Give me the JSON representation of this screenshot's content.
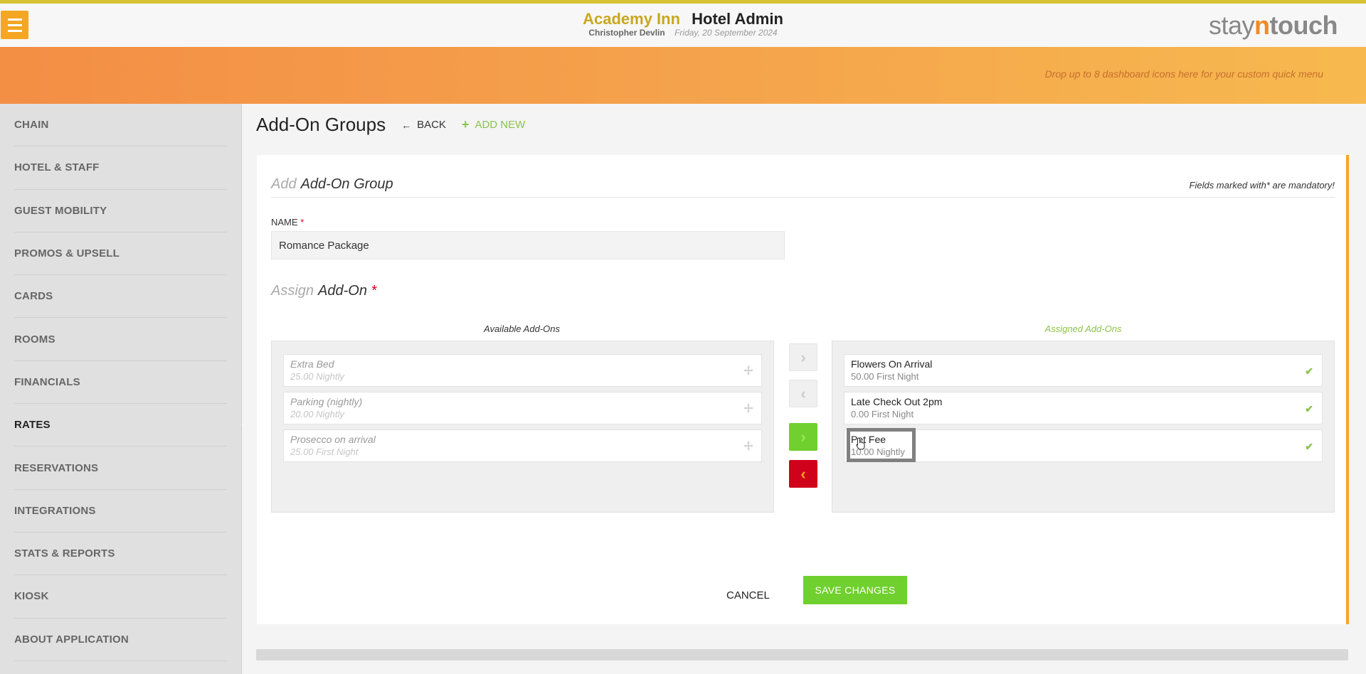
{
  "header": {
    "hotel_name": "Academy Inn",
    "admin_label": "Hotel Admin",
    "user_name": "Christopher Devlin",
    "date": "Friday, 20 September 2024",
    "brand_prefix": "stay",
    "brand_n": "n",
    "brand_suffix": "touch"
  },
  "quickbar": {
    "hint": "Drop up to 8 dashboard icons here for your custom quick menu"
  },
  "sidebar": {
    "items": [
      {
        "label": "CHAIN"
      },
      {
        "label": "HOTEL & STAFF"
      },
      {
        "label": "GUEST MOBILITY"
      },
      {
        "label": "PROMOS & UPSELL"
      },
      {
        "label": "CARDS"
      },
      {
        "label": "ROOMS"
      },
      {
        "label": "FINANCIALS"
      },
      {
        "label": "RATES",
        "active": true
      },
      {
        "label": "RESERVATIONS"
      },
      {
        "label": "INTEGRATIONS"
      },
      {
        "label": "STATS & REPORTS"
      },
      {
        "label": "KIOSK"
      },
      {
        "label": "ABOUT APPLICATION"
      }
    ]
  },
  "page": {
    "title": "Add-On Groups",
    "back_label": "BACK",
    "add_new_label": "ADD NEW"
  },
  "form": {
    "heading_prefix": "Add",
    "heading": "Add-On Group",
    "mandatory_note": "Fields marked with* are mandatory!",
    "name_label": "NAME",
    "required_mark": "*",
    "name_value": "Romance Package",
    "assign_prefix": "Assign",
    "assign_heading": "Add-On",
    "available_label": "Available Add-Ons",
    "assigned_label": "Assigned Add-Ons",
    "available": [
      {
        "name": "Extra Bed",
        "price": "25.00 Nightly"
      },
      {
        "name": "Parking (nightly)",
        "price": "20.00 Nightly"
      },
      {
        "name": "Prosecco on arrival",
        "price": "25.00 First Night"
      }
    ],
    "assigned": [
      {
        "name": "Flowers On Arrival",
        "price": "50.00 First Night"
      },
      {
        "name": "Late Check Out 2pm",
        "price": "0.00 First Night"
      },
      {
        "name": "Pet Fee",
        "price": "10.00 Nightly"
      }
    ],
    "cancel_label": "CANCEL",
    "save_label": "SAVE CHANGES"
  },
  "colors": {
    "accent_orange": "#f5a623",
    "green": "#6fd02e",
    "red": "#d0021b",
    "gold": "#c8a81e"
  }
}
